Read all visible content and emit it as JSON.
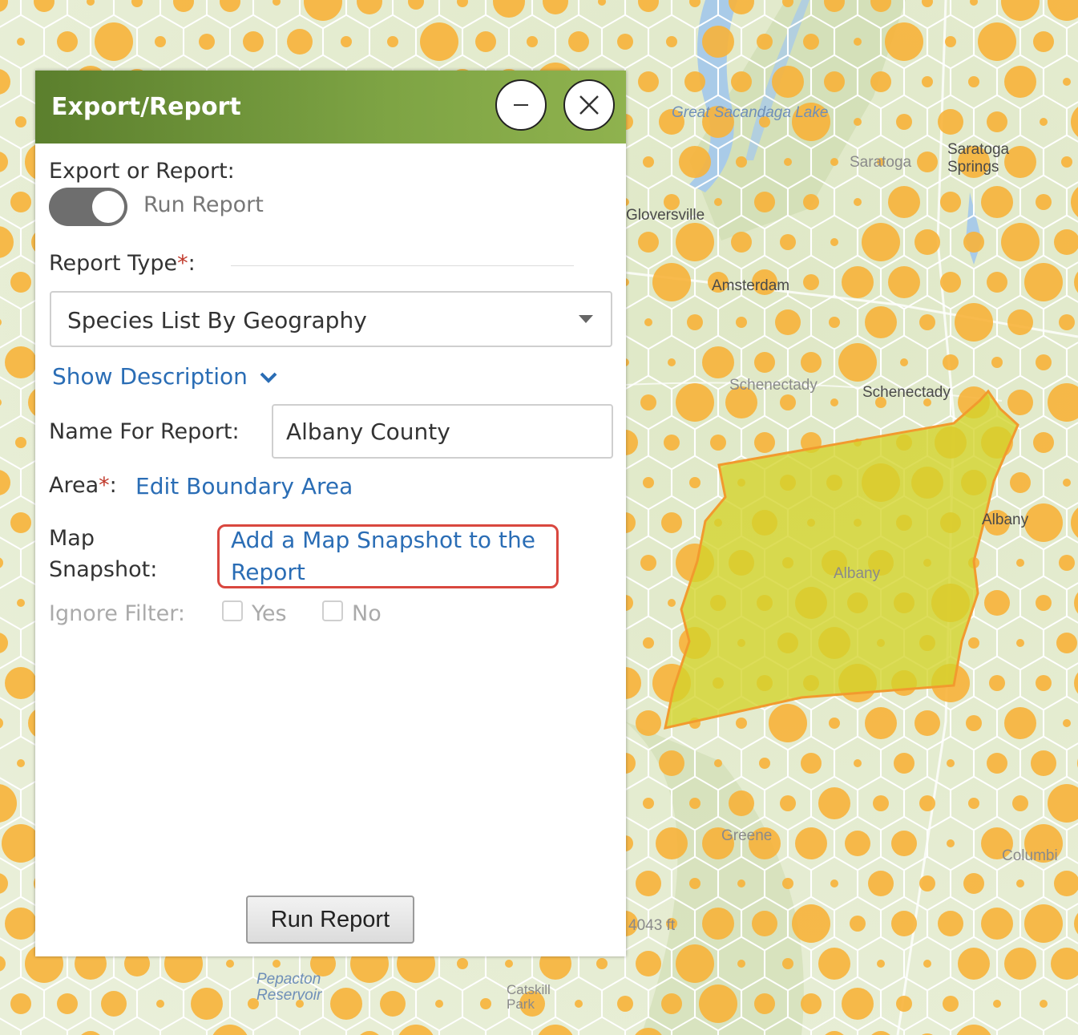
{
  "map": {
    "labels": {
      "great_sacandaga_lake": "Great Sacandaga Lake",
      "saratoga": "Saratoga",
      "saratoga_springs": "Saratoga Springs",
      "gloversville": "Gloversville",
      "amsterdam": "Amsterdam",
      "schenectady_faint": "Schenectady",
      "schenectady": "Schenectady",
      "albany": "Albany",
      "albany_county": "Albany",
      "greene": "Greene",
      "columbia": "Columbi",
      "elevation": "4043 ft",
      "pepacton_reservoir": "Pepacton Reservoir",
      "catskill_park": "Catskill Park"
    },
    "colors": {
      "hex_dot": "#f7b23a",
      "selected_area": "#d4d42a",
      "selected_outline": "#f29a2e"
    }
  },
  "panel": {
    "title": "Export/Report",
    "minimize_icon": "minus-icon",
    "close_icon": "close-icon",
    "export_or_report_label": "Export or Report:",
    "toggle_text": "Run Report",
    "report_type_label": "Report Type",
    "required_mark": "*",
    "colon": ":",
    "report_type_value": "Species List By Geography",
    "show_description": "Show Description",
    "name_label": "Name For Report:",
    "name_value": "Albany County",
    "area_label": "Area",
    "edit_boundary": "Edit Boundary Area",
    "map_label": "Map",
    "snapshot_label": "Snapshot:",
    "snapshot_link": "Add a Map Snapshot to the Report",
    "ignore_filter_label": "Ignore Filter:",
    "yes_label": "Yes",
    "no_label": "No",
    "run_button": "Run Report"
  }
}
